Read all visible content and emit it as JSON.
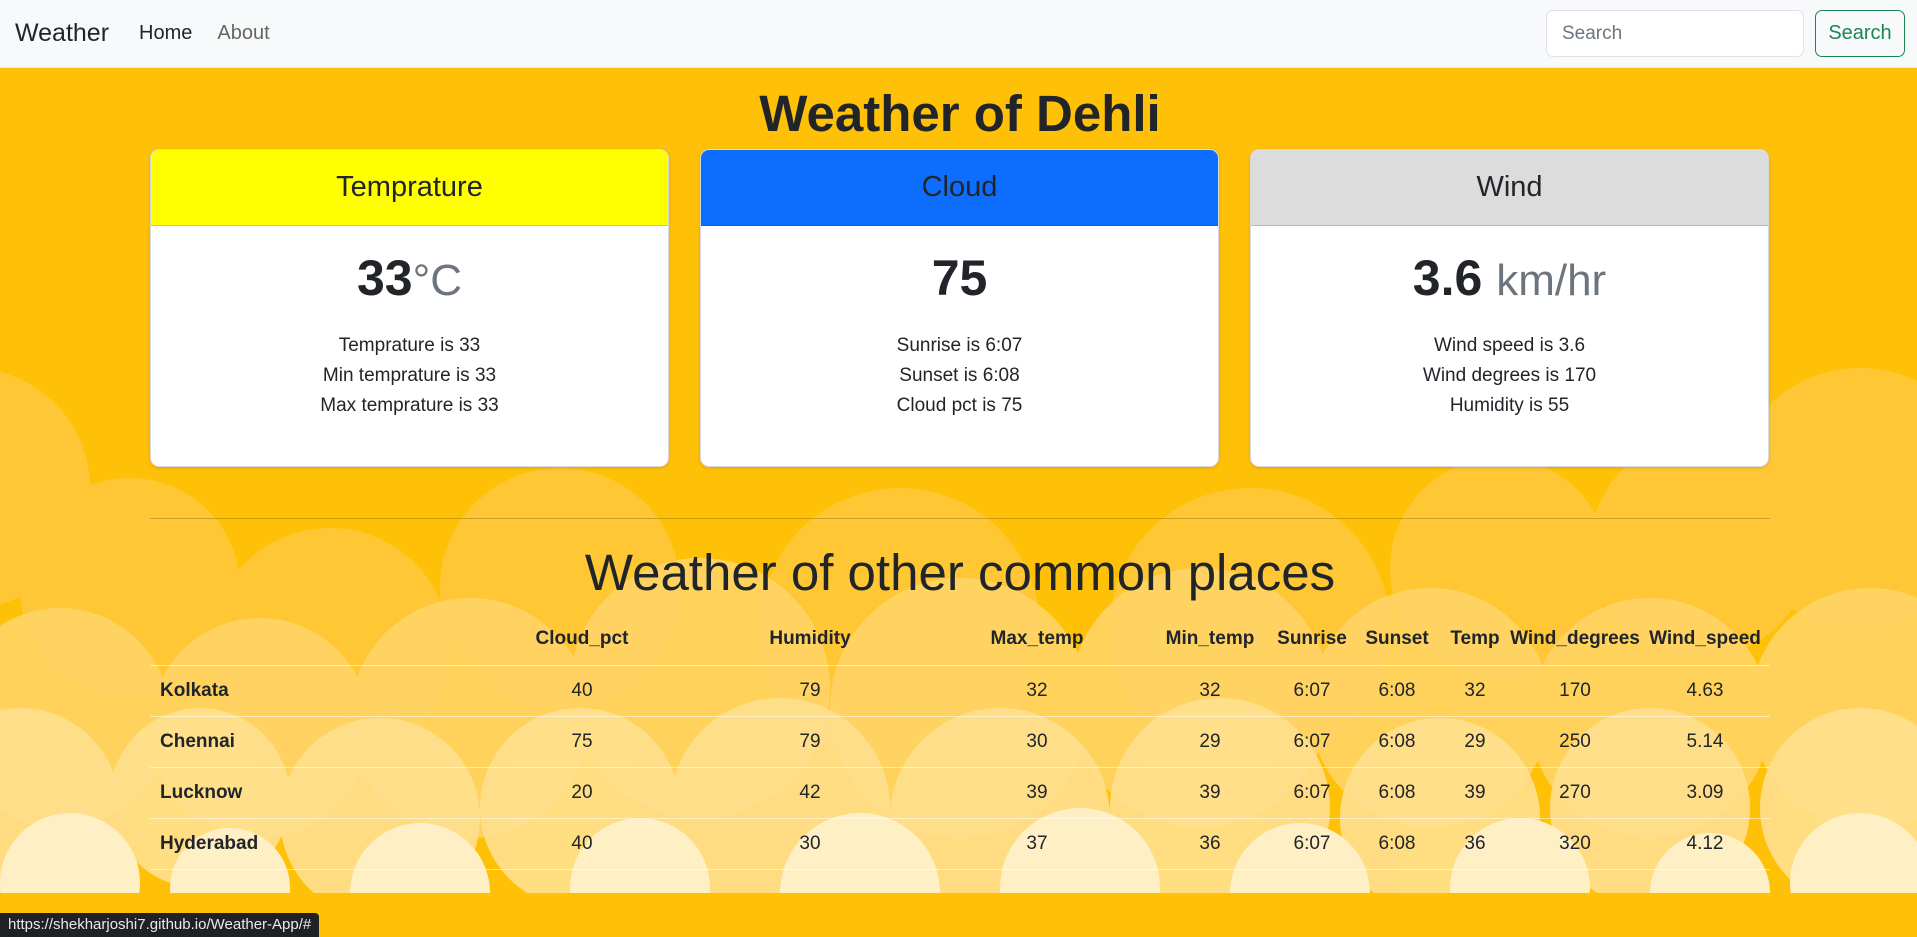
{
  "navbar": {
    "brand": "Weather",
    "links": [
      "Home",
      "About"
    ],
    "search_placeholder": "Search",
    "search_button": "Search"
  },
  "title": "Weather of Dehli",
  "cards": [
    {
      "header": "Temprature",
      "header_color": "#ffff00",
      "value": "33",
      "unit": "°C",
      "lines": [
        "Temprature is 33",
        "Min temprature is 33",
        "Max temprature is 33"
      ]
    },
    {
      "header": "Cloud",
      "header_color": "#0d6efd",
      "value": "75",
      "unit": "",
      "lines": [
        "Sunrise is 6:07",
        "Sunset is 6:08",
        "Cloud pct is 75"
      ]
    },
    {
      "header": "Wind",
      "header_color": "#dcdcdc",
      "value": "3.6",
      "unit": "km/hr",
      "lines": [
        "Wind speed is 3.6",
        "Wind degrees is 170",
        "Humidity is 55"
      ]
    }
  ],
  "section_title": "Weather of other common places",
  "table": {
    "headers": [
      "",
      "Cloud_pct",
      "Humidity",
      "Max_temp",
      "Min_temp",
      "Sunrise",
      "Sunset",
      "Temp",
      "Wind_degrees",
      "Wind_speed"
    ],
    "rows": [
      [
        "Kolkata",
        "40",
        "79",
        "32",
        "32",
        "6:07",
        "6:08",
        "32",
        "170",
        "4.63"
      ],
      [
        "Chennai",
        "75",
        "79",
        "30",
        "29",
        "6:07",
        "6:08",
        "29",
        "250",
        "5.14"
      ],
      [
        "Lucknow",
        "20",
        "42",
        "39",
        "39",
        "6:07",
        "6:08",
        "39",
        "270",
        "3.09"
      ],
      [
        "Hyderabad",
        "40",
        "30",
        "37",
        "36",
        "6:07",
        "6:08",
        "36",
        "320",
        "4.12"
      ]
    ]
  },
  "status_url": "https://shekharjoshi7.github.io/Weather-App/#",
  "colors": {
    "background": "#ffc107",
    "search_button": "#198754"
  }
}
